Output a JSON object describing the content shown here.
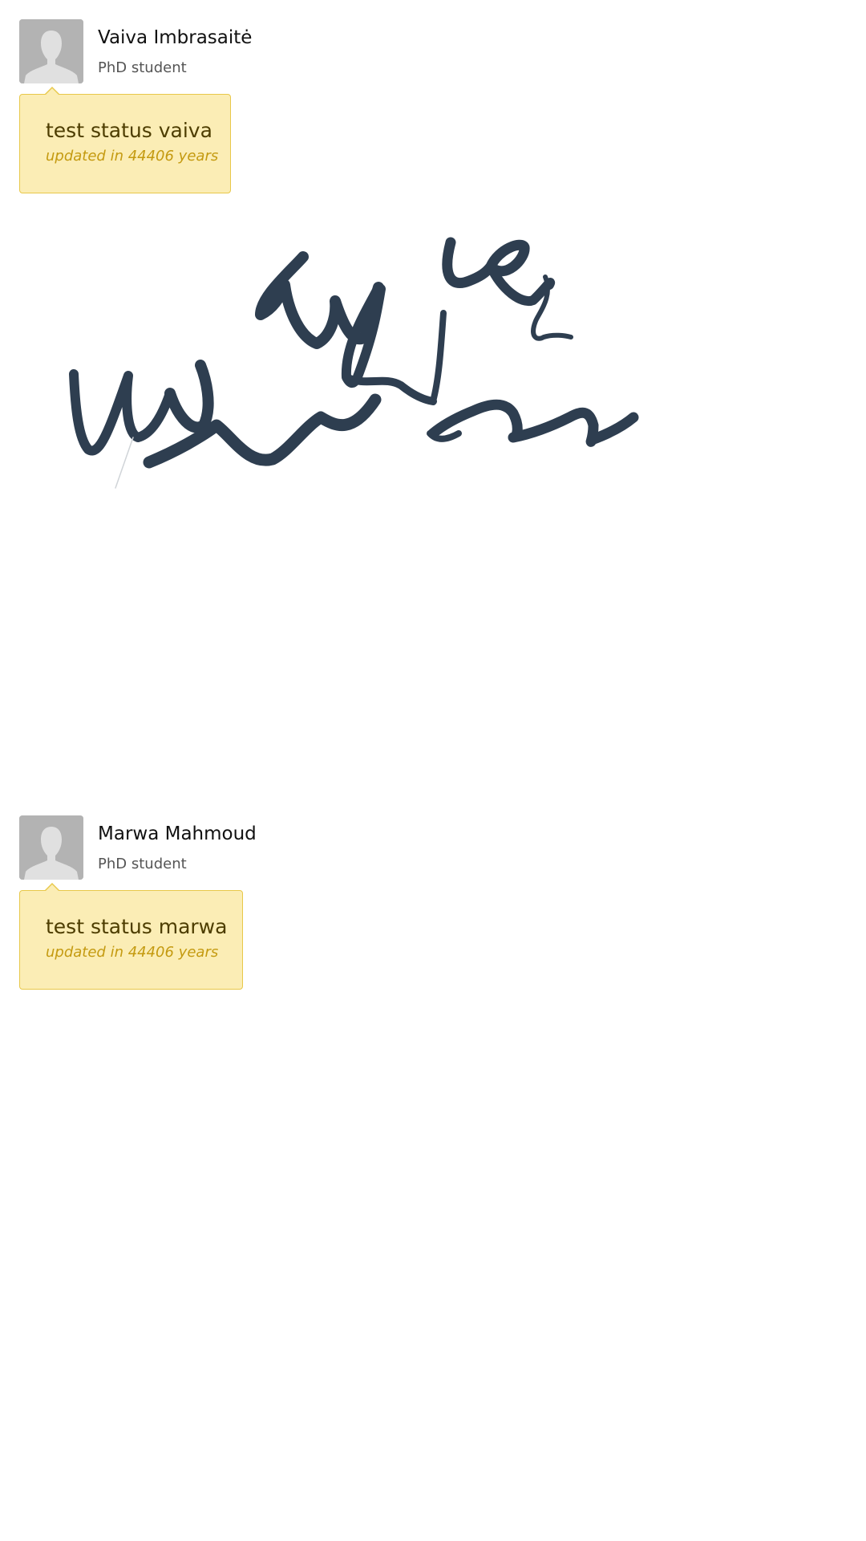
{
  "people": [
    {
      "name": "Vaiva Imbrasaitė",
      "role": "PhD student",
      "status": "test status vaiva",
      "updated": "updated in 44406 years"
    },
    {
      "name": "Marwa Mahmoud",
      "role": "PhD student",
      "status": "test status marwa",
      "updated": "updated in 44406 years"
    }
  ],
  "colors": {
    "bubble_background": "#fbedb5",
    "bubble_border": "#e8c84a",
    "status_text": "#4d3d00",
    "updated_text": "#c49a10",
    "ink": "#2e3e50"
  },
  "icons": {
    "avatar": "default-user-silhouette-icon"
  }
}
